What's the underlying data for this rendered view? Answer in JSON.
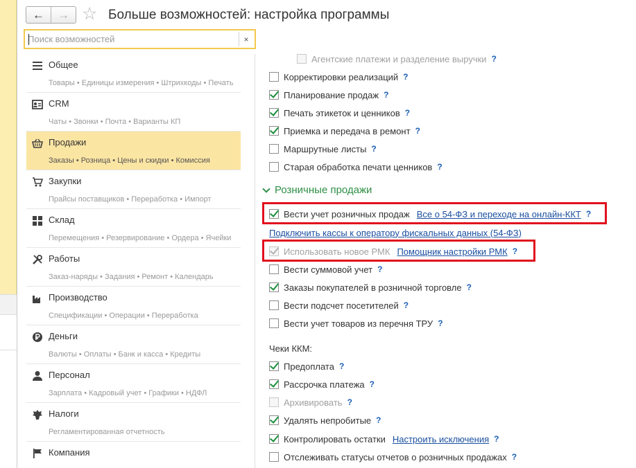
{
  "window": {
    "title": "Больше возможностей: настройка программы",
    "back_symbol": "←",
    "forward_symbol": "→",
    "favorite_symbol": "☆"
  },
  "search": {
    "placeholder": "Поиск возможностей",
    "value": "",
    "clear_symbol": "×"
  },
  "categories": [
    {
      "name": "Общее",
      "sub": "Товары • Единицы измерения • Штрихкоды • Печать",
      "icon": "menu-icon"
    },
    {
      "name": "CRM",
      "sub": "Чаты • Звонки • Почта • Варианты КП",
      "icon": "contact-card-icon"
    },
    {
      "name": "Продажи",
      "sub": "Заказы • Розница • Цены и скидки • Комиссия",
      "icon": "basket-icon",
      "selected": true
    },
    {
      "name": "Закупки",
      "sub": "Прайсы поставщиков • Переработка • Импорт",
      "icon": "cart-icon"
    },
    {
      "name": "Склад",
      "sub": "Перемещения • Резервирование • Ордера • Ячейки",
      "icon": "grid-icon"
    },
    {
      "name": "Работы",
      "sub": "Заказ-наряды • Задания • Ремонт • Календарь",
      "icon": "tools-icon"
    },
    {
      "name": "Производство",
      "sub": "Спецификации • Операции • Переработка",
      "icon": "factory-icon"
    },
    {
      "name": "Деньги",
      "sub": "Валюты • Оплаты • Банк и касса • Кредиты",
      "icon": "ruble-coin-icon"
    },
    {
      "name": "Персонал",
      "sub": "Зарплата • Кадровый учет • Графики • НДФЛ",
      "icon": "person-icon"
    },
    {
      "name": "Налоги",
      "sub": "Регламентированная отчетность",
      "icon": "emblem-icon"
    },
    {
      "name": "Компания",
      "sub": "",
      "icon": "flag-icon"
    }
  ],
  "options_top": [
    {
      "label": "Агентские платежи и разделение выручки",
      "checked": false,
      "disabled": true
    },
    {
      "label": "Корректировки реализаций",
      "checked": false
    },
    {
      "label": "Планирование продаж",
      "checked": true
    },
    {
      "label": "Печать этикеток и ценников",
      "checked": true
    },
    {
      "label": "Приемка и передача в ремонт",
      "checked": true
    },
    {
      "label": "Маршрутные листы",
      "checked": false
    },
    {
      "label": "Старая обработка печати ценников",
      "checked": false
    }
  ],
  "retail": {
    "title": "Розничные продажи",
    "keep_retail": {
      "label": "Вести учет розничных продаж",
      "checked": true,
      "link": "Все о 54-ФЗ и переходе на онлайн-ККТ"
    },
    "connect_link": "Подключить кассы к оператору фискальных данных (54-ФЗ)",
    "new_rmk": {
      "label": "Использовать новое РМК",
      "checked": true,
      "disabled": true,
      "link": "Помощник настройки РМК"
    },
    "options": [
      {
        "label": "Вести суммовой учет",
        "checked": false
      },
      {
        "label": "Заказы покупателей в розничной торговле",
        "checked": true
      },
      {
        "label": "Вести подсчет посетителей",
        "checked": false
      },
      {
        "label": "Вести учет товаров из перечня ТРУ",
        "checked": false
      }
    ]
  },
  "checks": {
    "title": "Чеки ККМ:",
    "options": [
      {
        "label": "Предоплата",
        "checked": true
      },
      {
        "label": "Рассрочка платежа",
        "checked": true
      },
      {
        "label": "Архивировать",
        "checked": false,
        "disabled": true
      },
      {
        "label": "Удалять непробитые",
        "checked": true
      },
      {
        "label": "Контролировать остатки",
        "checked": true,
        "link": "Настроить исключения"
      },
      {
        "label": "Отслеживать статусы отчетов о розничных продажах",
        "checked": false
      }
    ]
  },
  "help_symbol": "?",
  "colors": {
    "accent_yellow": "#fbe5a3",
    "search_border": "#f2c94c",
    "check_green": "#1a8f3a",
    "section_green": "#2e8f46",
    "link_blue": "#1a4fa0",
    "highlight_red": "#e0111d"
  }
}
